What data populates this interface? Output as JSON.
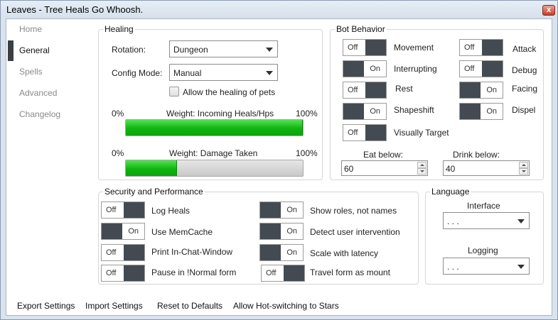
{
  "window": {
    "title": "Leaves - Tree Heals Go Whoosh.",
    "close_glyph": "x"
  },
  "nav": {
    "items": [
      {
        "label": "Home",
        "active": false
      },
      {
        "label": "General",
        "active": true
      },
      {
        "label": "Spells",
        "active": false
      },
      {
        "label": "Advanced",
        "active": false
      },
      {
        "label": "Changelog",
        "active": false
      }
    ]
  },
  "healing": {
    "title": "Healing",
    "rotation_label": "Rotation:",
    "rotation_value": "Dungeon",
    "config_label": "Config Mode:",
    "config_value": "Manual",
    "pets_checkbox_label": "Allow the healing of pets",
    "pets_checked": false,
    "weight1": {
      "label": "Weight: Incoming Heals/Hps",
      "min": "0%",
      "max": "100%",
      "value": 1.0
    },
    "weight2": {
      "label": "Weight: Damage Taken",
      "min": "0%",
      "max": "100%",
      "value": 0.29
    }
  },
  "bot": {
    "title": "Bot Behavior",
    "toggles": [
      {
        "label": "Movement",
        "state": "Off"
      },
      {
        "label": "Attack",
        "state": "Off"
      },
      {
        "label": "Interrupting",
        "state": "On"
      },
      {
        "label": "Debug",
        "state": "Off"
      },
      {
        "label": "Rest",
        "state": "Off"
      },
      {
        "label": "Facing",
        "state": "On"
      },
      {
        "label": "Shapeshift",
        "state": "On"
      },
      {
        "label": "Dispel",
        "state": "On"
      },
      {
        "label": "Visually Target",
        "state": "Off"
      }
    ],
    "eat_label": "Eat below:",
    "eat_value": "60",
    "drink_label": "Drink below:",
    "drink_value": "40"
  },
  "security": {
    "title": "Security and Performance",
    "toggles": [
      {
        "label": "Log Heals",
        "state": "Off"
      },
      {
        "label": "Show roles, not names",
        "state": "On"
      },
      {
        "label": "Use MemCache",
        "state": "On"
      },
      {
        "label": "Detect user intervention",
        "state": "On"
      },
      {
        "label": "Print In-Chat-Window",
        "state": "Off"
      },
      {
        "label": "Scale with latency",
        "state": "On"
      },
      {
        "label": "Pause in !Normal form",
        "state": "Off"
      },
      {
        "label": "Travel form as mount",
        "state": "Off"
      }
    ]
  },
  "language": {
    "title": "Language",
    "interface_label": "Interface",
    "interface_value": ". . .",
    "logging_label": "Logging",
    "logging_value": ". . ."
  },
  "footer": {
    "export": "Export Settings",
    "import": "Import Settings",
    "reset": "Reset to Defaults",
    "hot_switch": "Allow Hot-switching to Stars"
  },
  "colors": {
    "progress_green": "#10b410",
    "toggle_dark": "#444a51",
    "window_frame": "#d9e3ef"
  }
}
